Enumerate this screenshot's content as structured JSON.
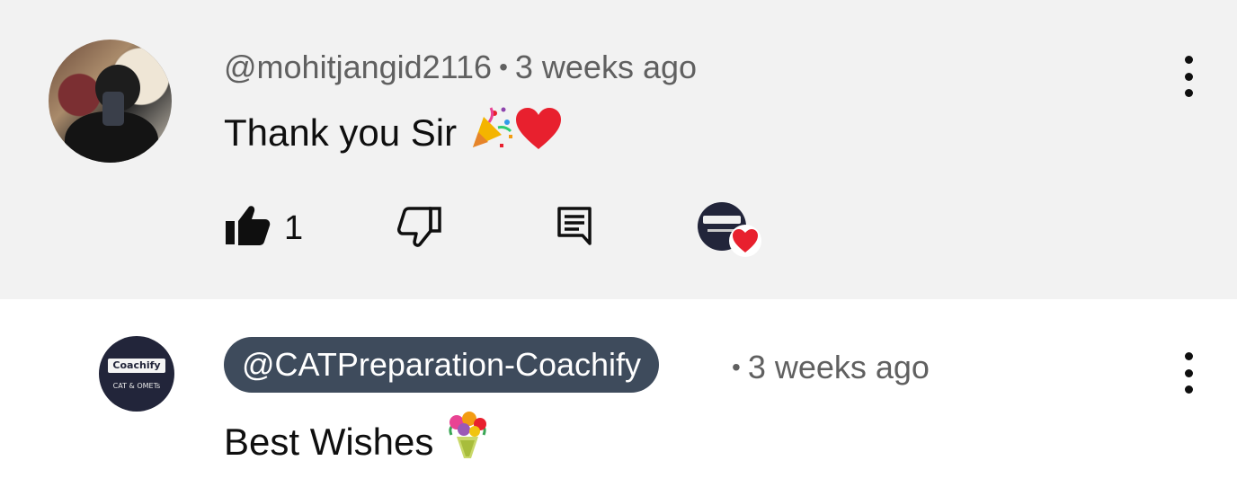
{
  "comment": {
    "author": "@mohitjangid2116",
    "separator": "•",
    "time": "3 weeks ago",
    "text": "Thank you Sir",
    "emojis": [
      "party-popper",
      "red-heart"
    ],
    "like_count": "1",
    "creator_heart": true
  },
  "reply": {
    "author": "@CATPreparation-Coachify",
    "separator": "•",
    "time": "3 weeks ago",
    "text": "Best Wishes",
    "emojis": [
      "bouquet"
    ],
    "channel_logo": {
      "brand": "Coachify",
      "tagline": "CAT & OMETs"
    }
  },
  "colors": {
    "highlight_bg": "#f2f2f2",
    "meta_text": "#606060",
    "body_text": "#0f0f0f",
    "author_chip_bg": "#3e4b5c",
    "heart_red": "#e8202e",
    "logo_navy": "#22253a"
  }
}
